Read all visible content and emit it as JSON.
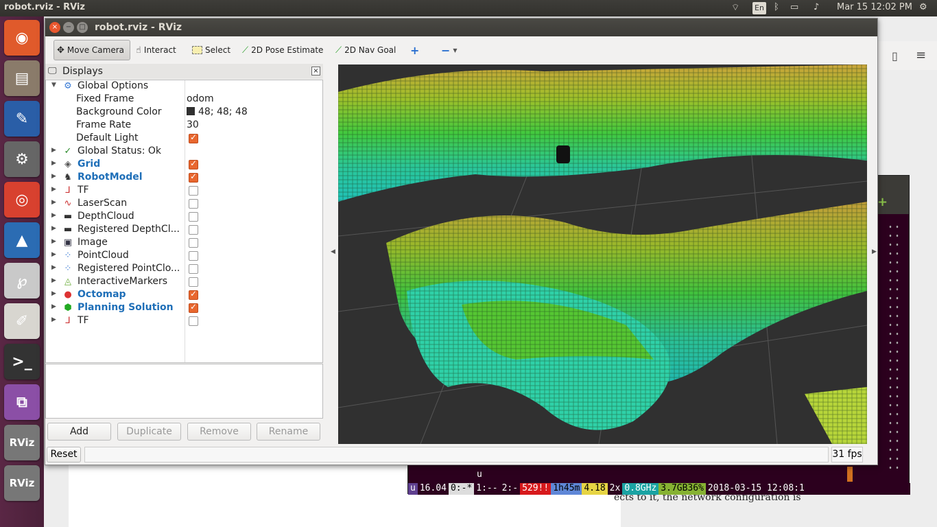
{
  "topbar": {
    "app_title": "robot.rviz - RViz",
    "keyboard_lang": "En",
    "clock": "Mar 15 12:02 PM"
  },
  "launcher": {
    "items": [
      {
        "name": "ubuntu-logo-icon",
        "glyph": "◉",
        "color": "#e05a2b"
      },
      {
        "name": "files-icon",
        "glyph": "▤",
        "color": "#8a7b6a"
      },
      {
        "name": "writer-icon",
        "glyph": "✎",
        "color": "#2a5ea7"
      },
      {
        "name": "system-settings-icon",
        "glyph": "⚙",
        "color": "#666"
      },
      {
        "name": "chrome-icon",
        "glyph": "◎",
        "color": "#d8412f"
      },
      {
        "name": "matlab-icon",
        "glyph": "▲",
        "color": "#2b6cb3"
      },
      {
        "name": "pdf-reader-icon",
        "glyph": "℘",
        "color": "#c9c9c9"
      },
      {
        "name": "text-editor-icon",
        "glyph": "✐",
        "color": "#d8d6d0"
      },
      {
        "name": "terminal-icon",
        "glyph": ">_",
        "color": "#333"
      },
      {
        "name": "remote-desktop-icon",
        "glyph": "⧉",
        "color": "#8b4fa6"
      },
      {
        "name": "rviz-icon-1",
        "glyph": "RViz",
        "color": "#777"
      },
      {
        "name": "rviz-icon-2",
        "glyph": "RViz",
        "color": "#777"
      }
    ]
  },
  "window": {
    "title": "robot.rviz - RViz"
  },
  "toolbar": {
    "move_camera": "Move Camera",
    "interact": "Interact",
    "select": "Select",
    "pose_estimate": "2D Pose Estimate",
    "nav_goal": "2D Nav Goal"
  },
  "displays": {
    "title": "Displays",
    "global_options": "Global Options",
    "fixed_frame_label": "Fixed Frame",
    "fixed_frame_value": "odom",
    "bg_color_label": "Background Color",
    "bg_color_value": "48; 48; 48",
    "frame_rate_label": "Frame Rate",
    "frame_rate_value": "30",
    "default_light_label": "Default Light",
    "global_status": "Global Status: Ok",
    "items": [
      {
        "label": "Grid",
        "bold": true,
        "checked": true,
        "icon": "◈"
      },
      {
        "label": "RobotModel",
        "bold": true,
        "checked": true,
        "icon": "♞"
      },
      {
        "label": "TF",
        "bold": false,
        "checked": false,
        "icon": "⅃"
      },
      {
        "label": "LaserScan",
        "bold": false,
        "checked": false,
        "icon": "∿"
      },
      {
        "label": "DepthCloud",
        "bold": false,
        "checked": false,
        "icon": "▬"
      },
      {
        "label": "Registered DepthCl...",
        "bold": false,
        "checked": false,
        "icon": "▬"
      },
      {
        "label": "Image",
        "bold": false,
        "checked": false,
        "icon": "▣"
      },
      {
        "label": "PointCloud",
        "bold": false,
        "checked": false,
        "icon": "⁘"
      },
      {
        "label": "Registered PointClo...",
        "bold": false,
        "checked": false,
        "icon": "⁘"
      },
      {
        "label": "InteractiveMarkers",
        "bold": false,
        "checked": false,
        "icon": "◬"
      },
      {
        "label": "Octomap",
        "bold": true,
        "checked": true,
        "icon": "●"
      },
      {
        "label": "Planning Solution",
        "bold": true,
        "checked": true,
        "icon": "⬢"
      },
      {
        "label": "TF",
        "bold": false,
        "checked": false,
        "icon": "⅃"
      }
    ],
    "buttons": {
      "add": "Add",
      "duplicate": "Duplicate",
      "remove": "Remove",
      "rename": "Rename"
    }
  },
  "status": {
    "reset": "Reset",
    "fps": "31 fps"
  },
  "terminal": {
    "prompt_fragment": "u",
    "status_segments": [
      {
        "text": "u",
        "bg": "#5f3f8f",
        "fg": "#fff"
      },
      {
        "text": "16.04",
        "bg": "#2c001e",
        "fg": "#fff"
      },
      {
        "text": "0:-*",
        "bg": "#dddddd",
        "fg": "#000"
      },
      {
        "text": "1:--",
        "bg": "#2c001e",
        "fg": "#fff"
      },
      {
        "text": "2:-",
        "bg": "#2c001e",
        "fg": "#fff"
      },
      {
        "text": "529!!",
        "bg": "#d7191c",
        "fg": "#fff"
      },
      {
        "text": "1h45m",
        "bg": "#5f87d7",
        "fg": "#000"
      },
      {
        "text": "4.18",
        "bg": "#e6d444",
        "fg": "#000"
      },
      {
        "text": "2x",
        "bg": "#2c001e",
        "fg": "#fff"
      },
      {
        "text": "0.8GHz",
        "bg": "#1aa3a3",
        "fg": "#fff"
      },
      {
        "text": "3.7GB36%",
        "bg": "#86b232",
        "fg": "#000"
      },
      {
        "text": "2018-03-15 12:08:1",
        "bg": "#2c001e",
        "fg": "#fff"
      }
    ]
  },
  "background_doc": {
    "text": "ects to it, the network configuration is"
  }
}
